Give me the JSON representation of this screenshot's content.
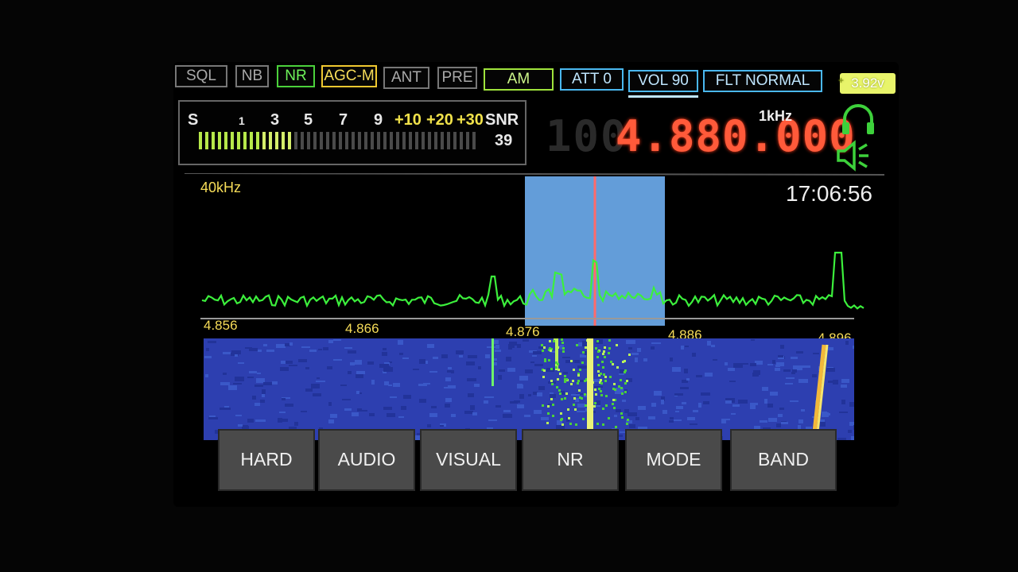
{
  "top_buttons": [
    {
      "label": "SQL"
    },
    {
      "label": "NB"
    },
    {
      "label": "NR"
    },
    {
      "label": "AGC-M"
    },
    {
      "label": "ANT"
    },
    {
      "label": "PRE"
    },
    {
      "label": "AM"
    },
    {
      "label": "ATT 0"
    },
    {
      "label": "VOL 90"
    },
    {
      "label": "FLT NORMAL"
    }
  ],
  "battery": {
    "value": "3.92v",
    "color": "#e8f46a"
  },
  "smeter": {
    "labels": [
      "S",
      "1",
      "3",
      "5",
      "7",
      "9",
      "+10",
      "+20",
      "+30"
    ],
    "level_fraction": 0.33,
    "snr_label": "SNR",
    "snr_value": "39"
  },
  "frequency": {
    "dim_digits": "100",
    "active": "4.880.000",
    "step": "1kHz",
    "color": "#ff5a3a"
  },
  "clock": "17:06:56",
  "span": "40kHz",
  "scale_ticks": [
    "4.856",
    "4.866",
    "4.876",
    "4.886",
    "4.896"
  ],
  "icons": {
    "headphones": "headphones-icon",
    "speaker": "speaker-icon"
  },
  "menu": [
    {
      "label": "HARD"
    },
    {
      "label": "AUDIO"
    },
    {
      "label": "VISUAL"
    },
    {
      "label": "NR"
    },
    {
      "label": "MODE"
    },
    {
      "label": "BAND"
    }
  ],
  "colors": {
    "spectrum": "#3cf03c",
    "passband": "#74b8ff",
    "marker": "#ff6a6a",
    "waterfall": "#2d3fb0"
  }
}
